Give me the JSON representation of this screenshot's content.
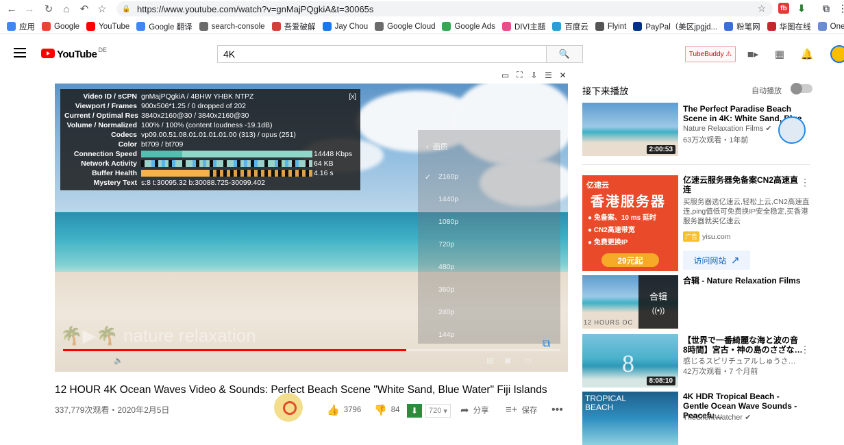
{
  "browser": {
    "url": "https://www.youtube.com/watch?v=gnMajPQgkiA&t=30065s",
    "bookmarks": [
      {
        "label": "应用",
        "color": "#4285f4"
      },
      {
        "label": "Google",
        "color": "#ea4335"
      },
      {
        "label": "YouTube",
        "color": "#ff0000"
      },
      {
        "label": "Google 翻译",
        "color": "#4285f4"
      },
      {
        "label": "search-console",
        "color": "#6b6b6b"
      },
      {
        "label": "吾爱破解",
        "color": "#d43f3a"
      },
      {
        "label": "Jay Chou",
        "color": "#1877f2"
      },
      {
        "label": "Google Cloud",
        "color": "#6b6b6b"
      },
      {
        "label": "Google Ads",
        "color": "#34a853"
      },
      {
        "label": "DIVI主题",
        "color": "#e94c89"
      },
      {
        "label": "百度云",
        "color": "#2a9fd6"
      },
      {
        "label": "Flyint",
        "color": "#555555"
      },
      {
        "label": "PayPal（美区jpgjd...",
        "color": "#003087"
      },
      {
        "label": "粉笔网",
        "color": "#3a6fd8"
      },
      {
        "label": "华图在线",
        "color": "#c8262d"
      },
      {
        "label": "One.cloud",
        "color": "#6a8bd6"
      }
    ]
  },
  "header": {
    "logo_text": "YouTube",
    "logo_country": "DE",
    "search_value": "4K",
    "tubebuddy_label": "TubeBuddy ⚠"
  },
  "player": {
    "stats": {
      "close": "[x]",
      "rows": [
        {
          "k": "Video ID / sCPN",
          "v": "gnMajPQgkiA / 4BHW YHBK NTPZ"
        },
        {
          "k": "Viewport / Frames",
          "v": "900x506*1.25 / 0 dropped of 202"
        },
        {
          "k": "Current / Optimal Res",
          "v": "3840x2160@30 / 3840x2160@30"
        },
        {
          "k": "Volume / Normalized",
          "v": "100% / 100% (content loudness -19.1dB)"
        },
        {
          "k": "Codecs",
          "v": "vp09.00.51.08.01.01.01.01.00 (313) / opus (251)"
        },
        {
          "k": "Color",
          "v": "bt709 / bt709"
        },
        {
          "k": "Connection Speed",
          "v": "14448 Kbps"
        },
        {
          "k": "Network Activity",
          "v": "64 KB"
        },
        {
          "k": "Buffer Health",
          "v": "4.16 s"
        },
        {
          "k": "Mystery Text",
          "v": "s:8 t:30095.32 b:30088.725-30099.402"
        }
      ]
    },
    "quality_menu": {
      "header": "画质",
      "selected": "2160p",
      "options": [
        "2160p",
        "1440p",
        "1080p",
        "720p",
        "480p",
        "360p",
        "240p",
        "144p"
      ]
    },
    "progress_fraction": 0.69,
    "watermark": "nature relaxation"
  },
  "video": {
    "title": "12 HOUR 4K Ocean Waves Video & Sounds: Perfect Beach Scene \"White Sand, Blue Water\" Fiji Islands",
    "meta": "337,779次观看・2020年2月5日",
    "likes": "3796",
    "dislikes": "84",
    "download_res": "720",
    "share": "分享",
    "save": "保存"
  },
  "sidebar": {
    "up_next": "接下来播放",
    "autoplay": "自动播放",
    "items": [
      {
        "title": "The Perfect Paradise Beach Scene in 4K: White Sand, Blue",
        "channel": "Nature Relaxation Films ✔",
        "meta": "63万次观看・1年前",
        "duration": "2:00:53"
      },
      {
        "title": "合辑 - Nature Relaxation Films",
        "overlay": "合辑",
        "overlay_sub": "((•))",
        "thumb_caption": "12 HOURS OC"
      },
      {
        "title": "【世界で一番綺麗な海と波の音 8時間】宮古・神の島のさざな…",
        "channel": "感じるスピリチュアルしゅうさ…",
        "meta": "42万次观看・7 个月前",
        "duration": "8:08:10",
        "thumb_number": "8"
      },
      {
        "title": "4K HDR Tropical Beach - Gentle Ocean Wave Sounds - Peacefu…",
        "channel": "TheSilentWatcher ✔",
        "thumb_text": "TROPICAL BEACH"
      }
    ],
    "ad": {
      "title": "亿速云服务器免备案CN2高速直连",
      "desc": "买服务器选亿速云,轻松上云,CN2高速直连,ping值低可免费换IP安全稳定,买香港服务器就买亿速云",
      "badge": "广告",
      "domain": "yisu.com",
      "visit": "访问网站",
      "banner_brand": "亿速云",
      "banner_head": "香港服务器",
      "banner_points": [
        "免备案、10 ms 延时",
        "CN2高速带宽",
        "免费更换IP"
      ],
      "banner_price": "29元起"
    }
  }
}
